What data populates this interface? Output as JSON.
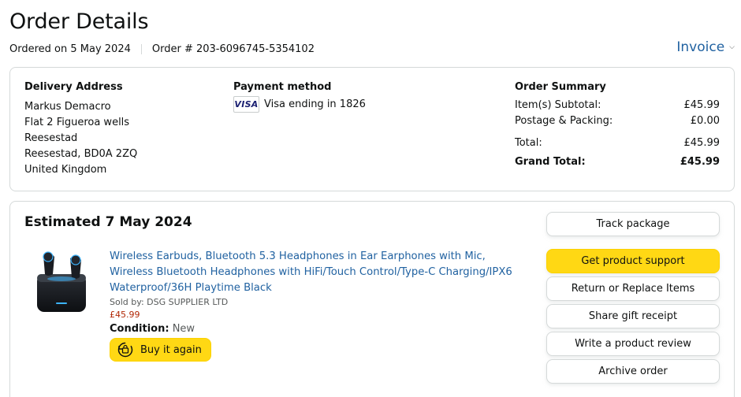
{
  "header": {
    "title": "Order Details",
    "ordered_on": "Ordered on 5 May 2024",
    "order_number": "Order # 203-6096745-5354102",
    "invoice_label": "Invoice"
  },
  "delivery": {
    "heading": "Delivery Address",
    "lines": [
      "Markus Demacro",
      "Flat 2 Figueroa wells",
      "Reesestad",
      "Reesestad, BD0A 2ZQ",
      "United Kingdom"
    ]
  },
  "payment": {
    "heading": "Payment method",
    "card_brand": "VISA",
    "card_text": "Visa ending in 1826"
  },
  "summary": {
    "heading": "Order Summary",
    "subtotal_label": "Item(s) Subtotal:",
    "subtotal_value": "£45.99",
    "postage_label": "Postage & Packing:",
    "postage_value": "£0.00",
    "total_label": "Total:",
    "total_value": "£45.99",
    "grand_label": "Grand Total:",
    "grand_value": "£45.99"
  },
  "shipment": {
    "estimated": "Estimated 7 May 2024",
    "product_title": "Wireless Earbuds, Bluetooth 5.3 Headphones in Ear Earphones with Mic, Wireless Bluetooth Headphones with HiFi/Touch Control/Type-C Charging/IPX6 Waterproof/36H Playtime Black",
    "sold_by": "Sold by: DSG SUPPLIER LTD",
    "price": "£45.99",
    "condition_label": "Condition:",
    "condition_value": "New",
    "buy_again": "Buy it again"
  },
  "actions": {
    "track": "Track package",
    "support": "Get product support",
    "return": "Return or Replace Items",
    "gift": "Share gift receipt",
    "review": "Write a product review",
    "archive": "Archive order"
  },
  "colors": {
    "link": "#2162a1",
    "primary_button": "#ffd814",
    "price": "#b12704"
  }
}
